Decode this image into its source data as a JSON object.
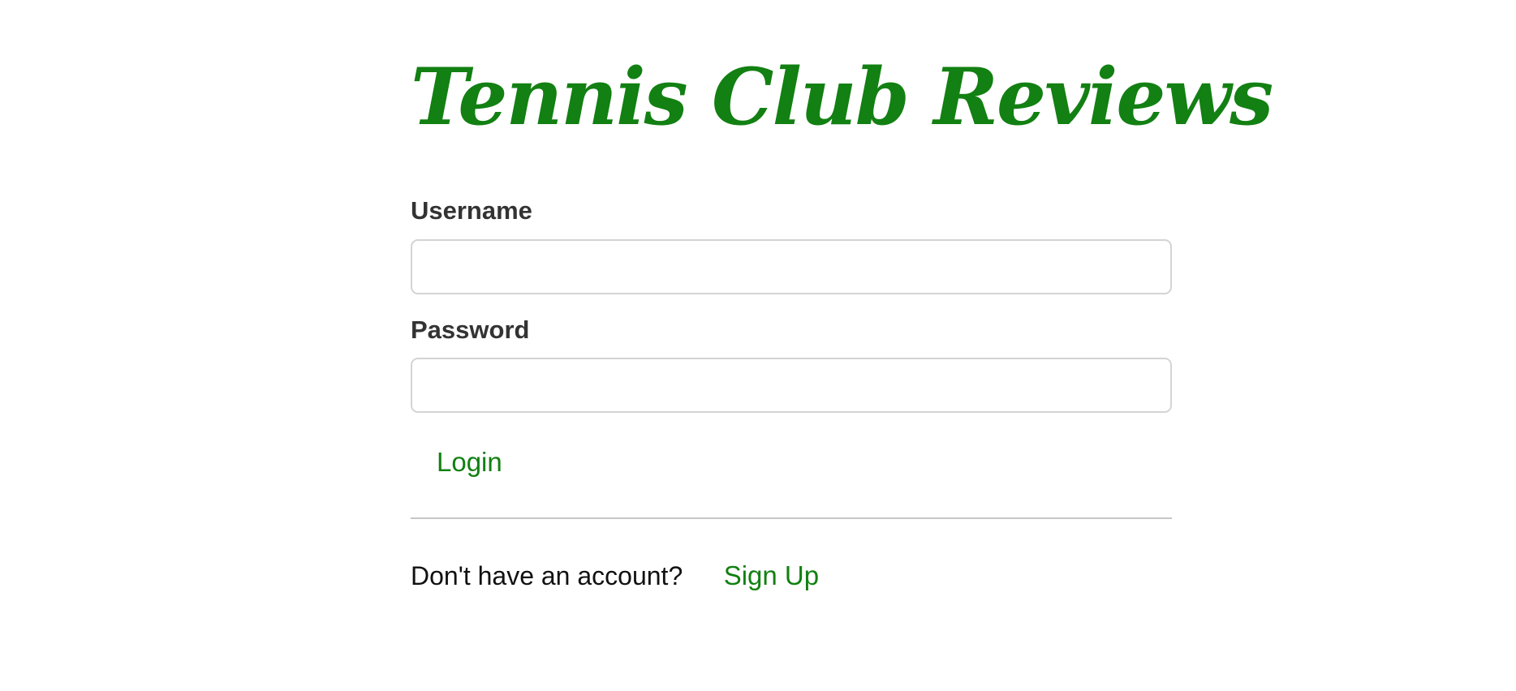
{
  "header": {
    "title": "Tennis Club Reviews"
  },
  "login_form": {
    "username_label": "Username",
    "username_value": "",
    "password_label": "Password",
    "password_value": "",
    "login_label": "Login"
  },
  "signup": {
    "prompt": "Don't have an account?",
    "link_label": "Sign Up"
  },
  "colors": {
    "brand": "#128012",
    "label_text": "#333333",
    "input_border": "#d4d4d4",
    "divider": "#c6c6c6"
  }
}
